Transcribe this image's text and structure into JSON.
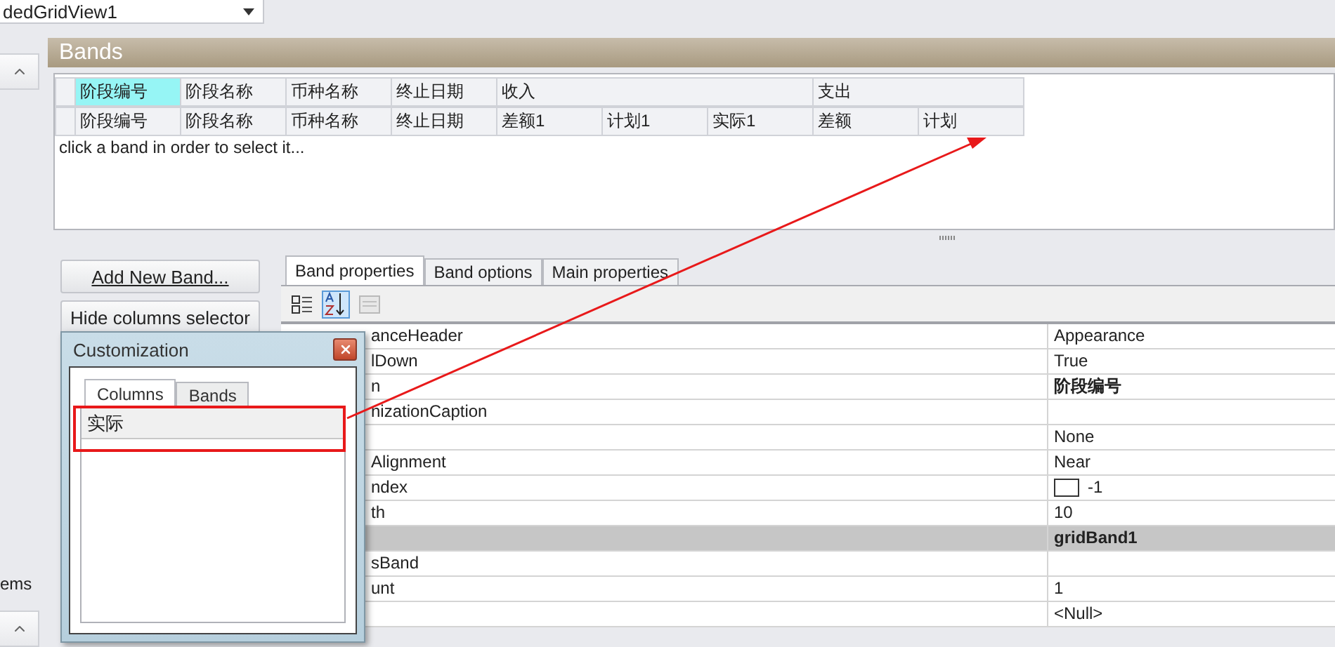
{
  "view_selector": {
    "value": "dedGridView1"
  },
  "side_strip": {
    "label": "ems"
  },
  "bands_panel": {
    "title": "Bands",
    "hint": "click a band in order to select it...",
    "bands": [
      {
        "caption": "阶段编号",
        "selected": true,
        "columns": [
          "阶段编号"
        ]
      },
      {
        "caption": "阶段名称",
        "selected": false,
        "columns": [
          "阶段名称"
        ]
      },
      {
        "caption": "币种名称",
        "selected": false,
        "columns": [
          "币种名称"
        ]
      },
      {
        "caption": "终止日期",
        "selected": false,
        "columns": [
          "终止日期"
        ]
      },
      {
        "caption": "收入",
        "selected": false,
        "columns": [
          "差额1",
          "计划1",
          "实际1"
        ]
      },
      {
        "caption": "支出",
        "selected": false,
        "columns": [
          "差额",
          "计划"
        ]
      }
    ]
  },
  "buttons": [
    {
      "label": "Add New Band...",
      "underlined": true
    },
    {
      "label": "Hide columns selector",
      "underlined": false
    }
  ],
  "property_tabs": [
    {
      "label": "Band properties",
      "selected": true
    },
    {
      "label": "Band options",
      "selected": false
    },
    {
      "label": "Main properties",
      "selected": false
    }
  ],
  "toolbar": [
    {
      "kind": "categorized",
      "on": false,
      "disabled": false
    },
    {
      "kind": "alphabetical",
      "on": true,
      "disabled": false
    },
    {
      "kind": "pages",
      "on": false,
      "disabled": true
    }
  ],
  "properties": [
    {
      "name": "anceHeader",
      "value": "Appearance",
      "kind": "text",
      "selected": false
    },
    {
      "name": "lDown",
      "value": "True",
      "kind": "text",
      "selected": false
    },
    {
      "name": "n",
      "value": "阶段编号",
      "kind": "bold",
      "selected": false
    },
    {
      "name": "nizationCaption",
      "selected": false
    },
    {
      "value": "None",
      "kind": "text",
      "selected": false
    },
    {
      "name": "Alignment",
      "value": "Near",
      "kind": "text",
      "selected": false
    },
    {
      "name": "ndex",
      "value": "-1",
      "kind": "image",
      "selected": false
    },
    {
      "name": "th",
      "value": "10",
      "kind": "text",
      "selected": false
    },
    {
      "value": "gridBand1",
      "kind": "bold",
      "selected": true
    },
    {
      "name": "sBand",
      "selected": false
    },
    {
      "name": "unt",
      "value": "1",
      "kind": "text",
      "selected": false
    },
    {
      "value": "<Null>",
      "kind": "text",
      "selected": false
    }
  ],
  "customization": {
    "title": "Customization",
    "tabs": [
      {
        "label": "Columns",
        "selected": true
      },
      {
        "label": "Bands",
        "selected": false
      }
    ],
    "items": [
      "实际"
    ]
  }
}
